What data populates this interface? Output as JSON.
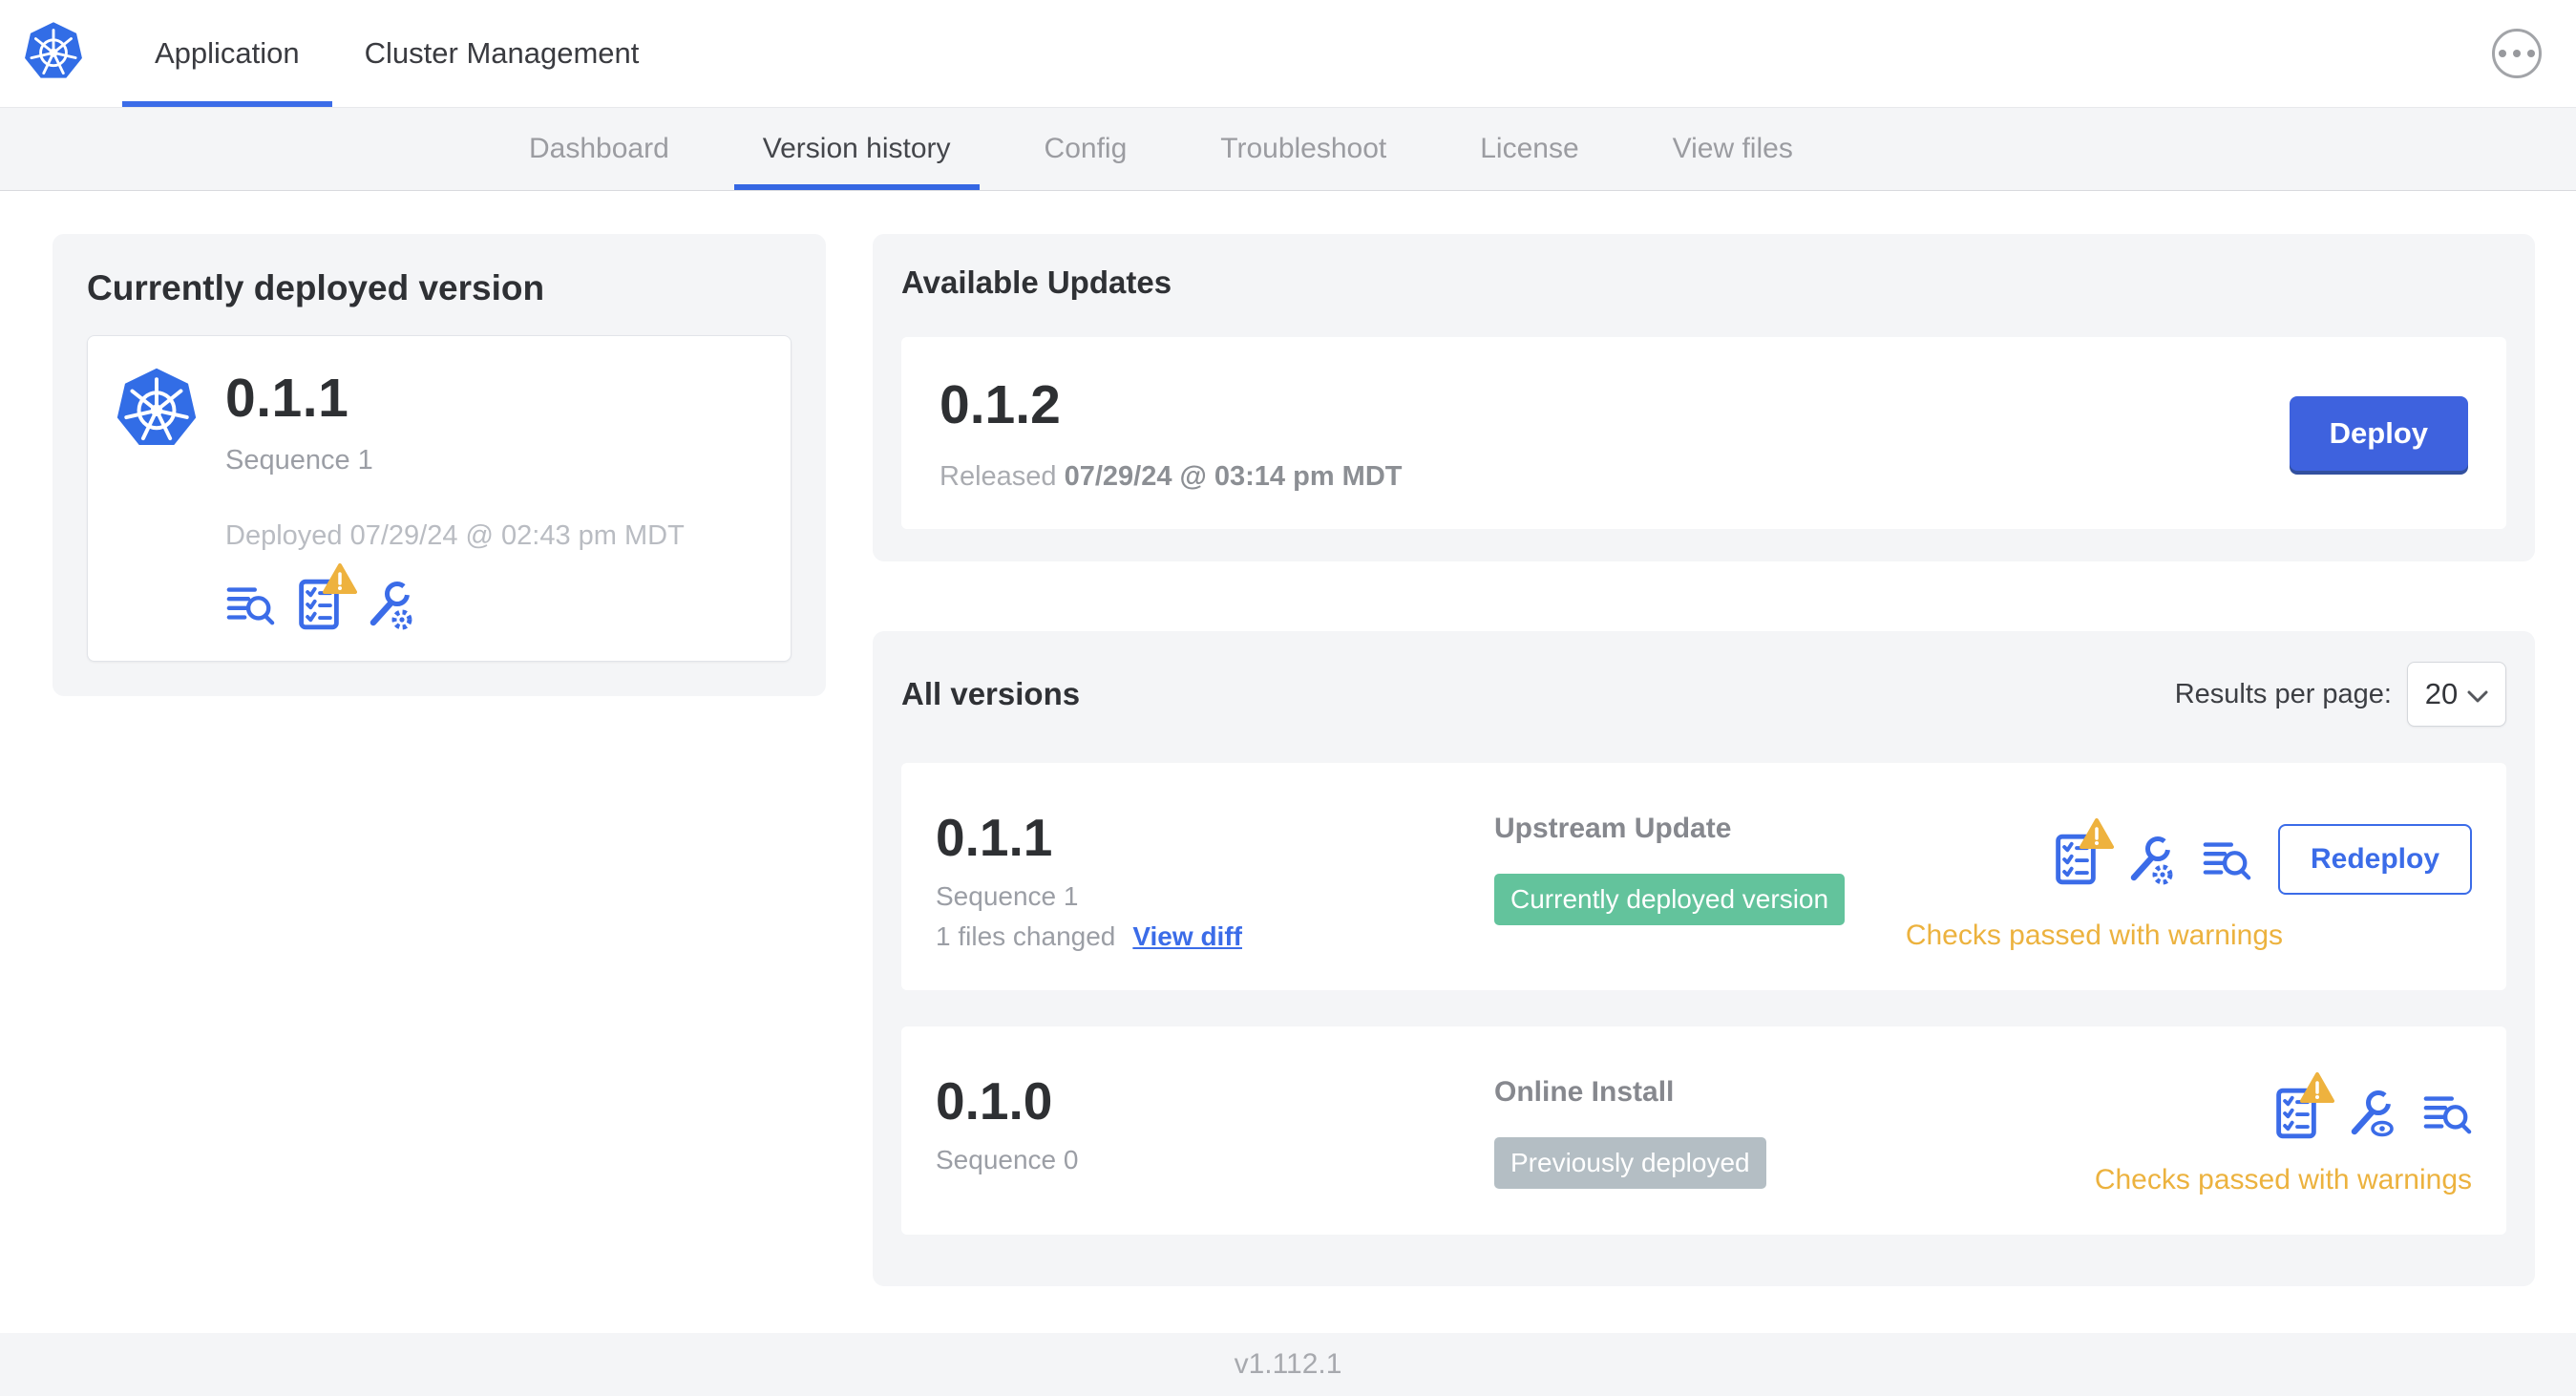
{
  "colors": {
    "accent_blue": "#3b6ce8",
    "button_blue": "#3e62de",
    "kubernetes_blue": "#326de6",
    "badge_green": "#63c39c",
    "badge_gray": "#b4bec4",
    "warning_amber": "#ecb23e",
    "card_gray": "#f4f5f7"
  },
  "header": {
    "tabs": [
      {
        "label": "Application"
      },
      {
        "label": "Cluster Management"
      }
    ],
    "active_tab": "Application",
    "menu_icon": "ellipsis-menu-icon",
    "logo_icon": "kubernetes-logo"
  },
  "subnav": {
    "tabs": [
      {
        "label": "Dashboard"
      },
      {
        "label": "Version history"
      },
      {
        "label": "Config"
      },
      {
        "label": "Troubleshoot"
      },
      {
        "label": "License"
      },
      {
        "label": "View files"
      }
    ],
    "active_tab": "Version history"
  },
  "currently_deployed": {
    "title": "Currently deployed version",
    "version": "0.1.1",
    "sequence": "Sequence 1",
    "deployed": "Deployed 07/29/24 @ 02:43 pm MDT",
    "icons": [
      "view-release-notes-icon",
      "preflight-checks-warning-icon",
      "edit-config-icon"
    ]
  },
  "available_updates": {
    "title": "Available Updates",
    "update": {
      "version": "0.1.2",
      "released_prefix": "Released",
      "released_date": "07/29/24 @ 03:14 pm MDT",
      "deploy_label": "Deploy"
    }
  },
  "all_versions": {
    "title": "All versions",
    "results_per_page_label": "Results per page:",
    "results_per_page_value": "20",
    "rows": [
      {
        "version": "0.1.1",
        "sequence": "Sequence 1",
        "files_changed": "1 files changed",
        "view_diff_label": "View diff",
        "source_type": "Upstream Update",
        "badge_label": "Currently deployed version",
        "badge_type": "green",
        "action_label": "Redeploy",
        "status_text": "Checks passed with warnings",
        "icons": [
          "preflight-checks-warning-icon",
          "edit-config-icon",
          "view-release-notes-icon"
        ]
      },
      {
        "version": "0.1.0",
        "sequence": "Sequence 0",
        "source_type": "Online Install",
        "badge_label": "Previously deployed",
        "badge_type": "gray",
        "status_text": "Checks passed with warnings",
        "icons": [
          "preflight-checks-warning-icon",
          "view-config-icon",
          "view-release-notes-icon"
        ]
      }
    ]
  },
  "footer": {
    "app_version": "v1.112.1"
  }
}
